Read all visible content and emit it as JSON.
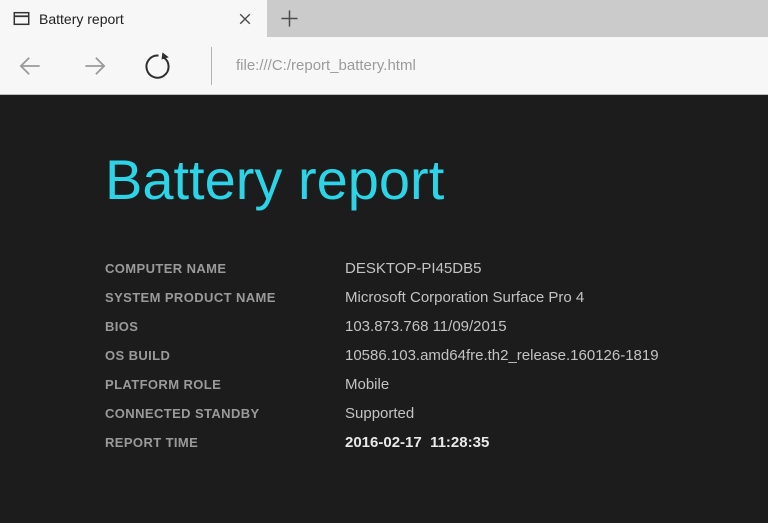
{
  "browser": {
    "tab": {
      "title": "Battery report",
      "favicon": "window-icon",
      "close_icon": "close-icon",
      "new_tab_icon": "plus-icon"
    },
    "toolbar": {
      "back_icon": "left-arrow-icon",
      "forward_icon": "right-arrow-icon",
      "refresh_icon": "refresh-icon"
    },
    "address_bar": {
      "url": "file:///C:/report_battery.html"
    }
  },
  "page": {
    "title": "Battery report",
    "report": {
      "rows": [
        {
          "label": "COMPUTER NAME",
          "value": "DESKTOP-PI45DB5"
        },
        {
          "label": "SYSTEM PRODUCT NAME",
          "value": "Microsoft Corporation Surface Pro 4"
        },
        {
          "label": "BIOS",
          "value": "103.873.768 11/09/2015"
        },
        {
          "label": "OS BUILD",
          "value": "10586.103.amd64fre.th2_release.160126-1819"
        },
        {
          "label": "PLATFORM ROLE",
          "value": "Mobile"
        },
        {
          "label": "CONNECTED STANDBY",
          "value": "Supported"
        },
        {
          "label": "REPORT TIME",
          "value": "2016-02-17  11:28:35"
        }
      ]
    }
  },
  "colors": {
    "accent_heading": "#2bd4e6",
    "page_background": "#1c1c1c",
    "chrome_background": "#f7f7f7",
    "tabbar_background": "#cbcbcb",
    "label_text": "#9a9a9a",
    "value_text": "#c3c3c3",
    "emphasis_text": "#e9e9e9",
    "url_text": "#9b9b9b"
  }
}
